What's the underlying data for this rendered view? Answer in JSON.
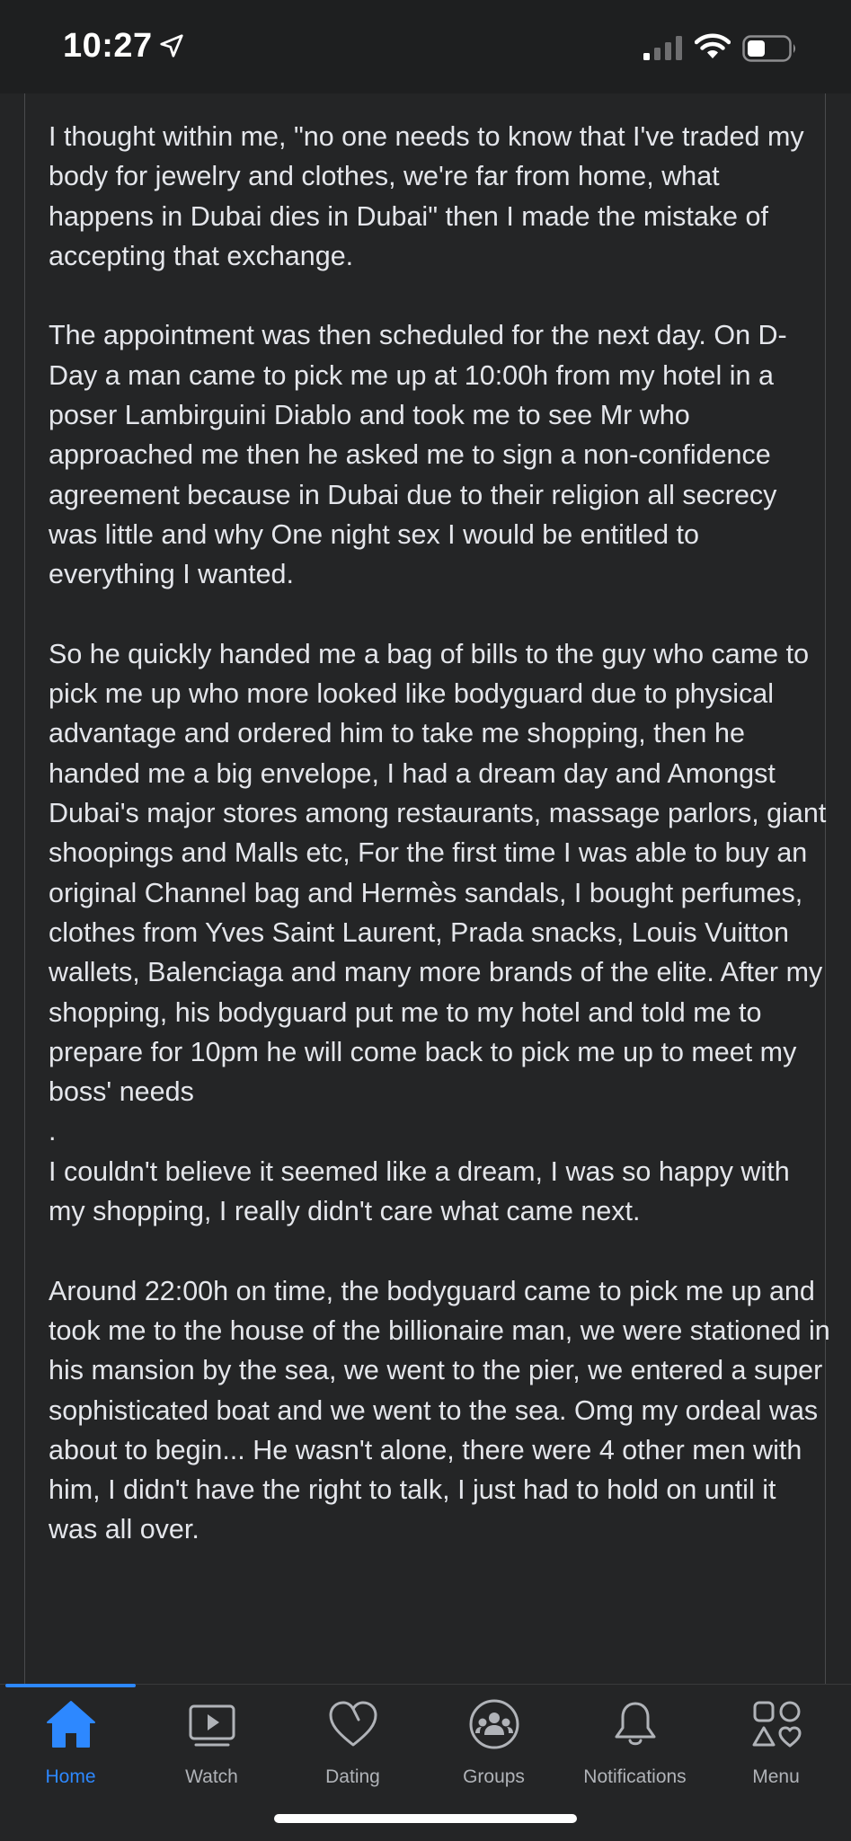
{
  "status_bar": {
    "time": "10:27",
    "icons": [
      "location-arrow-icon",
      "cellular-signal-icon",
      "wifi-icon",
      "battery-icon"
    ]
  },
  "post": {
    "paragraphs": [
      "I thought within me, \"no one needs to know that I've traded my body for jewelry and clothes, we're far from home, what happens in Dubai dies in Dubai\" then I made the mistake of accepting that exchange.",
      "The appointment was then scheduled for the next day. On D-Day a man came to pick me up at 10:00h from my hotel in a poser Lambirguini Diablo and took me to see Mr who approached me then he asked me to sign a non-confidence agreement because in Dubai due to their religion all secrecy was little and why One night sex I would be entitled to everything I wanted.",
      "So he quickly handed me a bag of bills to the guy who came to pick me up who more looked like bodyguard due to physical advantage and ordered him to take me shopping, then he handed me a big envelope, I had a dream day and Amongst Dubai's major stores among restaurants, massage parlors, giant shoopings and Malls etc, For the first time I was able to buy an original Channel bag and Hermès sandals, I bought perfumes, clothes from Yves Saint Laurent, Prada snacks, Louis Vuitton wallets, Balenciaga and many more brands of the elite. After my shopping, his bodyguard put me to my hotel and told me to prepare for 10pm he will come back to pick me up to meet my boss' needs\n.\nI couldn't believe it seemed like a dream, I was so happy with my shopping, I really didn't care what came next.",
      "Around 22:00h on time, the bodyguard came to pick me up and took me to the house of the billionaire man, we were stationed in his mansion by the sea, we went to the pier, we entered a super sophisticated boat and we went to the sea. Omg my ordeal was about to begin... He wasn't alone, there were 4 other men with him, I didn't have the right to talk, I just had to hold on until it was all over."
    ]
  },
  "tab_bar": {
    "active": "Home",
    "accent_color": "#2d88ff",
    "tabs": [
      {
        "label": "Home",
        "icon": "home-icon"
      },
      {
        "label": "Watch",
        "icon": "watch-video-icon"
      },
      {
        "label": "Dating",
        "icon": "dating-heart-icon"
      },
      {
        "label": "Groups",
        "icon": "groups-icon"
      },
      {
        "label": "Notifications",
        "icon": "bell-icon"
      },
      {
        "label": "Menu",
        "icon": "menu-shapes-icon"
      }
    ]
  }
}
